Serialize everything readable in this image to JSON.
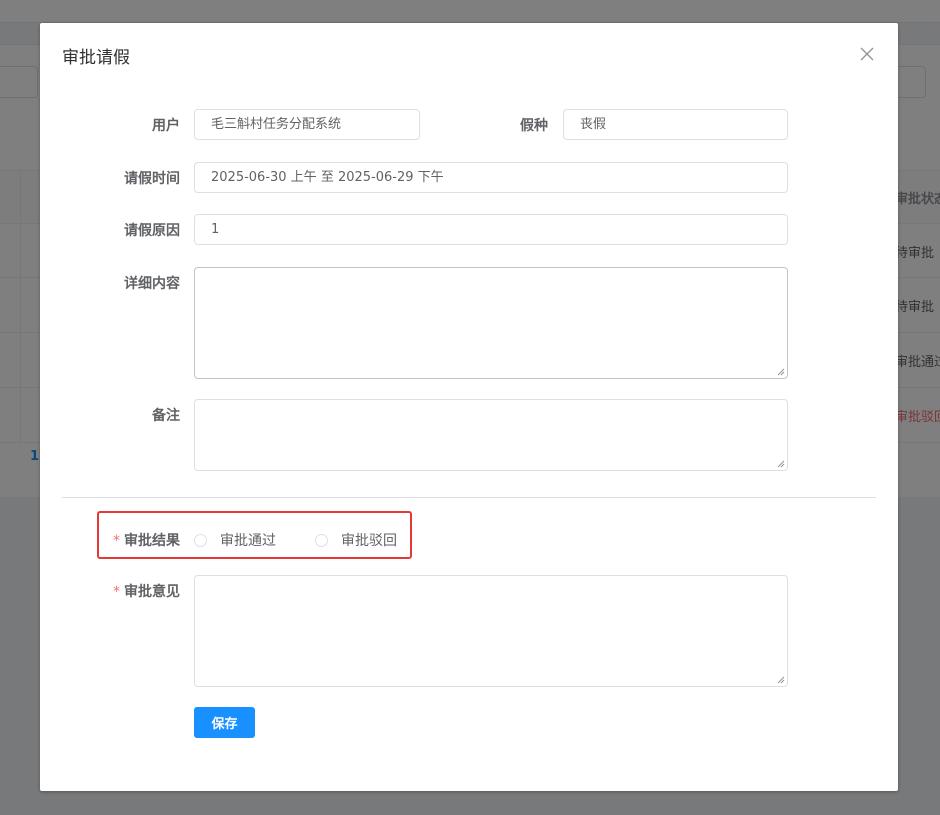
{
  "background": {
    "table": {
      "status_header": "审批状态",
      "status_values": [
        "待审批",
        "待审批",
        "审批通过",
        "审批驳回"
      ]
    },
    "pagination": {
      "current_page": "1"
    }
  },
  "dialog": {
    "title": "审批请假",
    "fields": {
      "user": {
        "label": "用户",
        "value": "毛三斛村任务分配系统"
      },
      "leave_type": {
        "label": "假种",
        "value": "丧假"
      },
      "leave_time": {
        "label": "请假时间",
        "value": "2025-06-30 上午 至 2025-06-29 下午"
      },
      "leave_reason": {
        "label": "请假原因",
        "value": "1"
      },
      "detail": {
        "label": "详细内容",
        "value": ""
      },
      "remark": {
        "label": "备注",
        "value": ""
      }
    },
    "approval": {
      "required_mark": "*",
      "result_label": "审批结果",
      "options": [
        "审批通过",
        "审批驳回"
      ],
      "opinion_label": "审批意见",
      "opinion_value": ""
    },
    "save_button": "保存"
  },
  "colors": {
    "primary": "#1890ff",
    "required": "#f56c6c",
    "highlight_border": "#e53935",
    "rejected_status": "#f56c6c"
  },
  "icons": {
    "close": "close-icon",
    "resize": "resize-grip-icon"
  }
}
